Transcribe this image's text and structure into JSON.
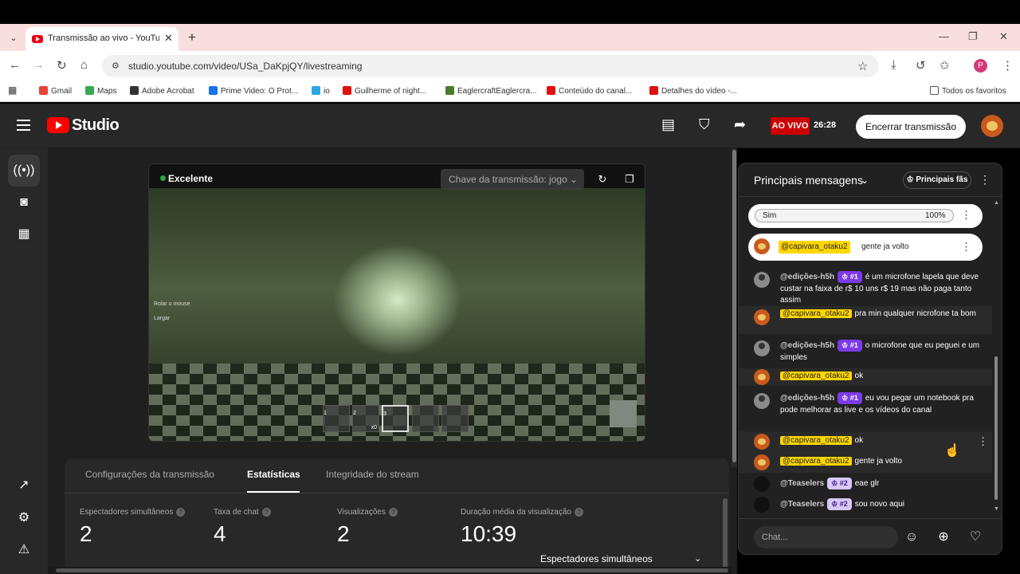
{
  "browser": {
    "tab_title": "Transmissão ao vivo - YouTube",
    "url": "studio.youtube.com/video/USa_DaKpjQY/livestreaming",
    "bookmarks": [
      {
        "label": "Gmail",
        "color": "#ea4335"
      },
      {
        "label": "Maps",
        "color": "#34a853"
      },
      {
        "label": "Adobe Acrobat",
        "color": "#333333"
      },
      {
        "label": "Prime Video: O Prot...",
        "color": "#1a73e8"
      },
      {
        "label": "io",
        "color": "#2aa9e0"
      },
      {
        "label": "Guilherme of night...",
        "color": "#e01010"
      },
      {
        "label": "EaglercraftEaglercra...",
        "color": "#4a7a2a"
      },
      {
        "label": "Conteúdo do canal...",
        "color": "#e01010"
      },
      {
        "label": "Detalhes do vídeo -...",
        "color": "#e01010"
      }
    ],
    "all_bookmarks": "Todos os favoritos",
    "profile_initial": "P"
  },
  "studio": {
    "logo_text": "Studio",
    "live_badge": "AO VIVO",
    "live_timer": "26:28",
    "end_stream": "Encerrar transmissão"
  },
  "player": {
    "quality": "Excelente",
    "stream_key": "Chave da transmissão: jogo",
    "hint_scroll": "Rolar o mouse",
    "hint_drop": "Largar",
    "hotbar": [
      "1",
      "2",
      "3",
      "",
      ""
    ],
    "hotbar_count": "x0"
  },
  "stats": {
    "tabs": [
      "Configurações da transmissão",
      "Estatísticas",
      "Integridade do stream"
    ],
    "active_tab": "Estatísticas",
    "items": [
      {
        "label": "Espectadores simultâneos",
        "value": "2"
      },
      {
        "label": "Taxa de chat",
        "value": "4"
      },
      {
        "label": "Visualizações",
        "value": "2"
      },
      {
        "label": "Duração média da visualização",
        "value": "10:39"
      }
    ],
    "selector": "Espectadores simultâneos"
  },
  "chat": {
    "title": "Principais mensagens",
    "top_fans": "Principais fãs",
    "poll": {
      "option": "Sim",
      "percent": "100%"
    },
    "pinned": {
      "author": "@capivara_otaku2",
      "text": "gente ja volto"
    },
    "messages": [
      {
        "author": "@edições-h5h",
        "badge": "#1",
        "text": "é um microfone lapela que deve custar na faixa de r$ 10 uns r$ 19 mas não paga tanto assim"
      },
      {
        "author": "@capivara_otaku2",
        "text": "pra min qualquer nicrofone ta bom"
      },
      {
        "author": "@edições-h5h",
        "badge": "#1",
        "text": "o microfone que eu peguei e um simples"
      },
      {
        "author": "@capivara_otaku2",
        "text": "ok"
      },
      {
        "author": "@edições-h5h",
        "badge": "#1",
        "text": "eu vou pegar um notebook pra pode melhorar as live e os vídeos do canal"
      },
      {
        "author": "@capivara_otaku2",
        "text": "ok"
      },
      {
        "author": "@capivara_otaku2",
        "text": "gente ja volto"
      },
      {
        "author": "@Teaselers",
        "badge": "#2",
        "text": "eae glr"
      },
      {
        "author": "@Teaselers",
        "badge": "#2",
        "text": "sou novo aqui"
      }
    ],
    "input_placeholder": "Chat..."
  }
}
